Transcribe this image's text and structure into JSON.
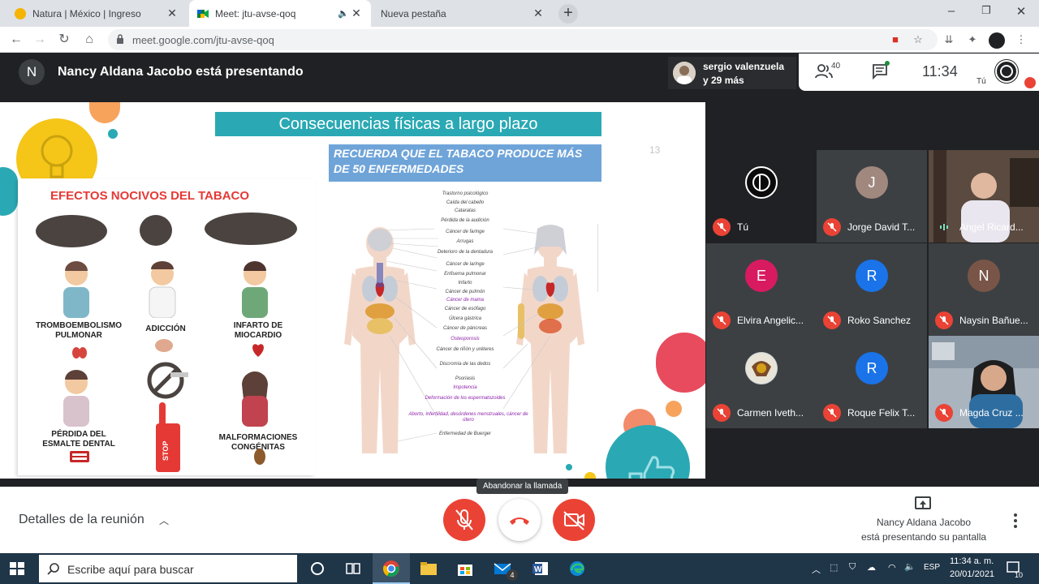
{
  "browser": {
    "tabs": [
      {
        "title": "Natura | México | Ingreso",
        "active": false
      },
      {
        "title": "Meet: jtu-avse-qoq",
        "active": true
      },
      {
        "title": "Nueva pestaña",
        "active": false
      }
    ],
    "url": "meet.google.com/jtu-avse-qoq"
  },
  "meet": {
    "presenter_initial": "N",
    "presenting_title": "Nancy Aldana Jacobo está presentando",
    "joiner_line1": "sergio valenzuela",
    "joiner_line2": "y 29 más",
    "people_count": "40",
    "clock": "11:34",
    "self_label": "Tú"
  },
  "slide": {
    "title": "Consecuencias físicas a largo plazo",
    "subtitle": "RECUERDA QUE EL TABACO PRODUCE MÁS DE 50 ENFERMEDADES",
    "page_number": "13",
    "effects_title": "EFECTOS NOCIVOS DEL TABACO",
    "effects": [
      "TROMBOEMBOLISMO PULMONAR",
      "ADICCIÓN",
      "INFARTO DE MIOCARDIO",
      "PÉRDIDA DEL ESMALTE DENTAL",
      "STOP",
      "MALFORMACIONES CONGÉNITAS"
    ],
    "diseases": [
      "Trastorno psicológico",
      "Caída del cabello",
      "Cataratas",
      "Pérdida de la audición",
      "Cáncer de faringe",
      "Arrugas",
      "Deterioro de la dentadura",
      "Cáncer de laringe",
      "Enfisema pulmonar",
      "Infarto",
      "Cáncer de pulmón",
      "Cáncer de mama",
      "Cáncer de esófago",
      "Úlcera gástrica",
      "Cáncer de páncreas",
      "Osteoporosis",
      "Cáncer de riñón y uréteres",
      "Discromía de las dedos",
      "Psoriasis",
      "Impotencia",
      "Deformación de los espermatozoides",
      "Aborto, infertilidad, desórdenes menstruales, cáncer de útero",
      "Enfermedad de Buerger"
    ]
  },
  "participants": [
    {
      "name": "Tú",
      "initial": "",
      "color": "#202124",
      "type": "logo"
    },
    {
      "name": "Jorge David T...",
      "initial": "J",
      "color": "#a1887f",
      "type": "avatar"
    },
    {
      "name": "Angel Ricard...",
      "initial": "",
      "color": "#5a4a3f",
      "type": "video"
    },
    {
      "name": "Elvira Angelic...",
      "initial": "E",
      "color": "#d81b60",
      "type": "avatar"
    },
    {
      "name": "Roko Sanchez",
      "initial": "R",
      "color": "#1a73e8",
      "type": "avatar"
    },
    {
      "name": "Naysin Bañue...",
      "initial": "N",
      "color": "#795548",
      "type": "avatar"
    },
    {
      "name": "Carmen Iveth...",
      "initial": "",
      "color": "#cfd8dc",
      "type": "photo"
    },
    {
      "name": "Roque Felix T...",
      "initial": "R",
      "color": "#1a73e8",
      "type": "avatar"
    },
    {
      "name": "Magda Cruz ...",
      "initial": "",
      "color": "#7b8fa3",
      "type": "video"
    }
  ],
  "bottom": {
    "details_label": "Detalles de la reunión",
    "tooltip": "Abandonar la llamada",
    "share_line1": "Nancy Aldana Jacobo",
    "share_line2": "está presentando su pantalla"
  },
  "taskbar": {
    "search_placeholder": "Escribe aquí para buscar",
    "mail_badge": "4",
    "lang": "ESP",
    "time": "11:34 a. m.",
    "date": "20/01/2021",
    "notif_count": "10"
  }
}
